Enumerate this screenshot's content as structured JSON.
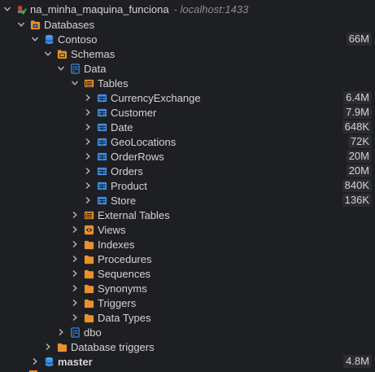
{
  "connection": {
    "name": "na_minha_maquina_funciona",
    "host": "- localhost:1433"
  },
  "databases_label": "Databases",
  "contoso": {
    "name": "Contoso",
    "size": "66M"
  },
  "schemas_label": "Schemas",
  "data_schema": "Data",
  "tables_label": "Tables",
  "tables": [
    {
      "name": "CurrencyExchange",
      "size": "6.4M"
    },
    {
      "name": "Customer",
      "size": "7.9M"
    },
    {
      "name": "Date",
      "size": "648K"
    },
    {
      "name": "GeoLocations",
      "size": "72K"
    },
    {
      "name": "OrderRows",
      "size": "20M"
    },
    {
      "name": "Orders",
      "size": "20M"
    },
    {
      "name": "Product",
      "size": "840K"
    },
    {
      "name": "Store",
      "size": "136K"
    }
  ],
  "folders": [
    "External Tables",
    "Views",
    "Indexes",
    "Procedures",
    "Sequences",
    "Synonyms",
    "Triggers",
    "Data Types"
  ],
  "dbo_schema": "dbo",
  "database_triggers": "Database triggers",
  "master": {
    "name": "master",
    "size": "4.8M"
  },
  "icons": {
    "connection": "server-connection-icon",
    "database": "database-cylinder-icon",
    "folder": "folder-icon",
    "schema": "schema-icon",
    "table": "table-icon",
    "tables-folder": "tables-folder-icon",
    "views": "eye-icon"
  },
  "colors": {
    "orange": "#e8912d",
    "blue": "#3b8ee8",
    "background": "#1e1f22"
  }
}
